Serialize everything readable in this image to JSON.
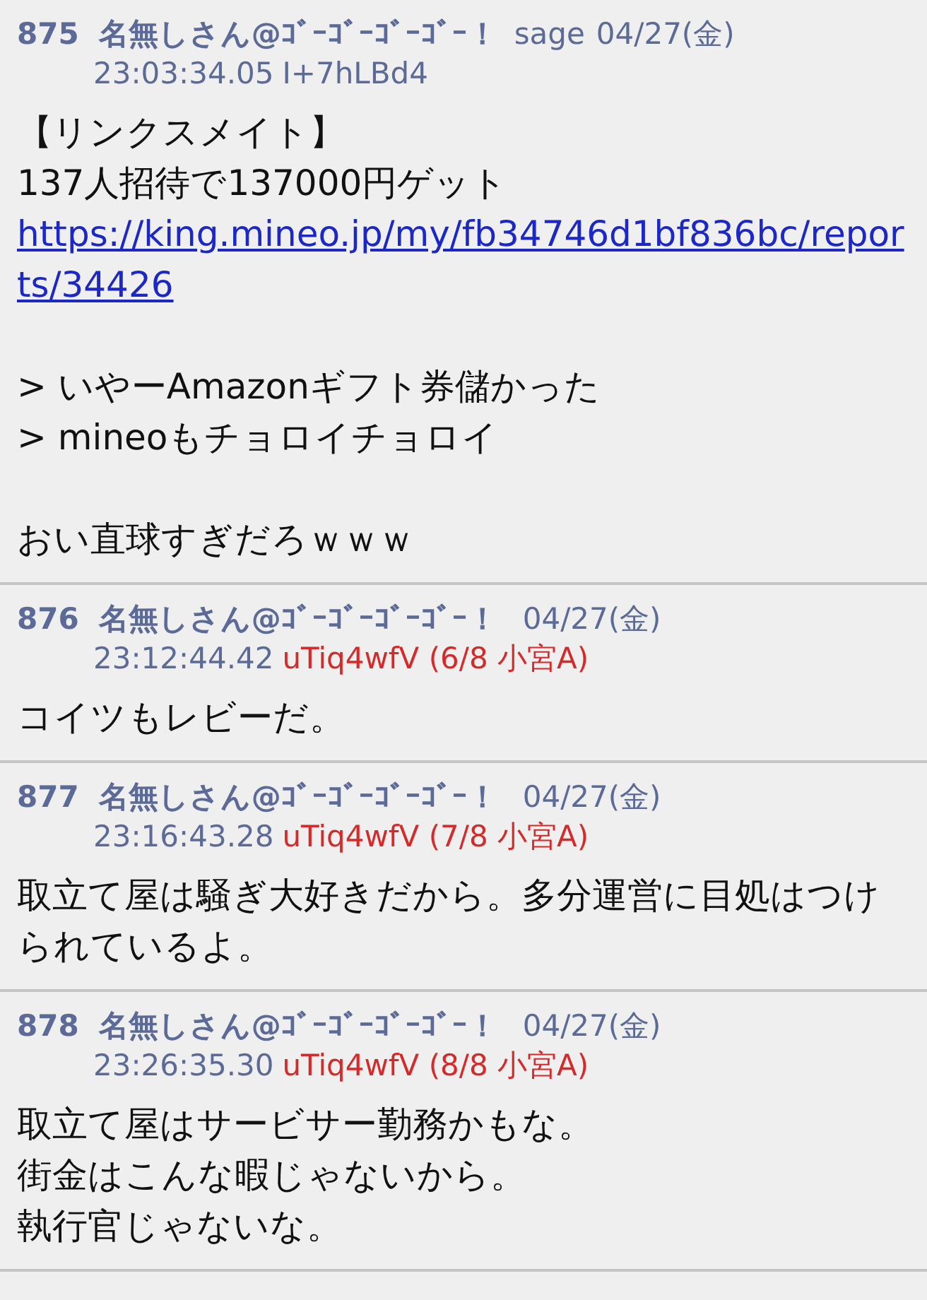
{
  "posts": [
    {
      "number": "875",
      "name": "名無しさん@ｺﾞｰｺﾞｰｺﾞｰｺﾞｰ！",
      "mail": "sage",
      "date": "04/27(金)",
      "time": "23:03:34.05",
      "id": "I+7hLBd4",
      "id_highlighted": false,
      "body": [
        [
          {
            "kind": "text",
            "text": "【リンクスメイト】"
          },
          {
            "kind": "text",
            "text": "137人招待で137000円ゲット"
          },
          {
            "kind": "link",
            "text": "https://king.mineo.jp/my/fb34746d1bf836bc/reports/34426"
          }
        ],
        [
          {
            "kind": "text",
            "text": "> いやーAmazonギフト券儲かった"
          },
          {
            "kind": "text",
            "text": "> mineoもチョロイチョロイ"
          }
        ],
        [
          {
            "kind": "text",
            "text": "おい直球すぎだろｗｗｗ"
          }
        ]
      ]
    },
    {
      "number": "876",
      "name": "名無しさん@ｺﾞｰｺﾞｰｺﾞｰｺﾞｰ！",
      "date": "04/27(金)",
      "time": "23:12:44.42",
      "id": "uTiq4wfV (6/8 小宮A)",
      "id_highlighted": true,
      "body": [
        [
          {
            "kind": "text",
            "text": "コイツもレビーだ。"
          }
        ]
      ]
    },
    {
      "number": "877",
      "name": "名無しさん@ｺﾞｰｺﾞｰｺﾞｰｺﾞｰ！",
      "date": "04/27(金)",
      "time": "23:16:43.28",
      "id": "uTiq4wfV (7/8 小宮A)",
      "id_highlighted": true,
      "body": [
        [
          {
            "kind": "text",
            "text": "取立て屋は騒ぎ大好きだから。多分運営に目処はつけられているよ。"
          }
        ]
      ]
    },
    {
      "number": "878",
      "name": "名無しさん@ｺﾞｰｺﾞｰｺﾞｰｺﾞｰ！",
      "date": "04/27(金)",
      "time": "23:26:35.30",
      "id": "uTiq4wfV (8/8 小宮A)",
      "id_highlighted": true,
      "body": [
        [
          {
            "kind": "text",
            "text": "取立て屋はサービサー勤務かもな。"
          },
          {
            "kind": "text",
            "text": "街金はこんな暇じゃないから。"
          },
          {
            "kind": "text",
            "text": "執行官じゃないな。"
          }
        ]
      ]
    }
  ]
}
